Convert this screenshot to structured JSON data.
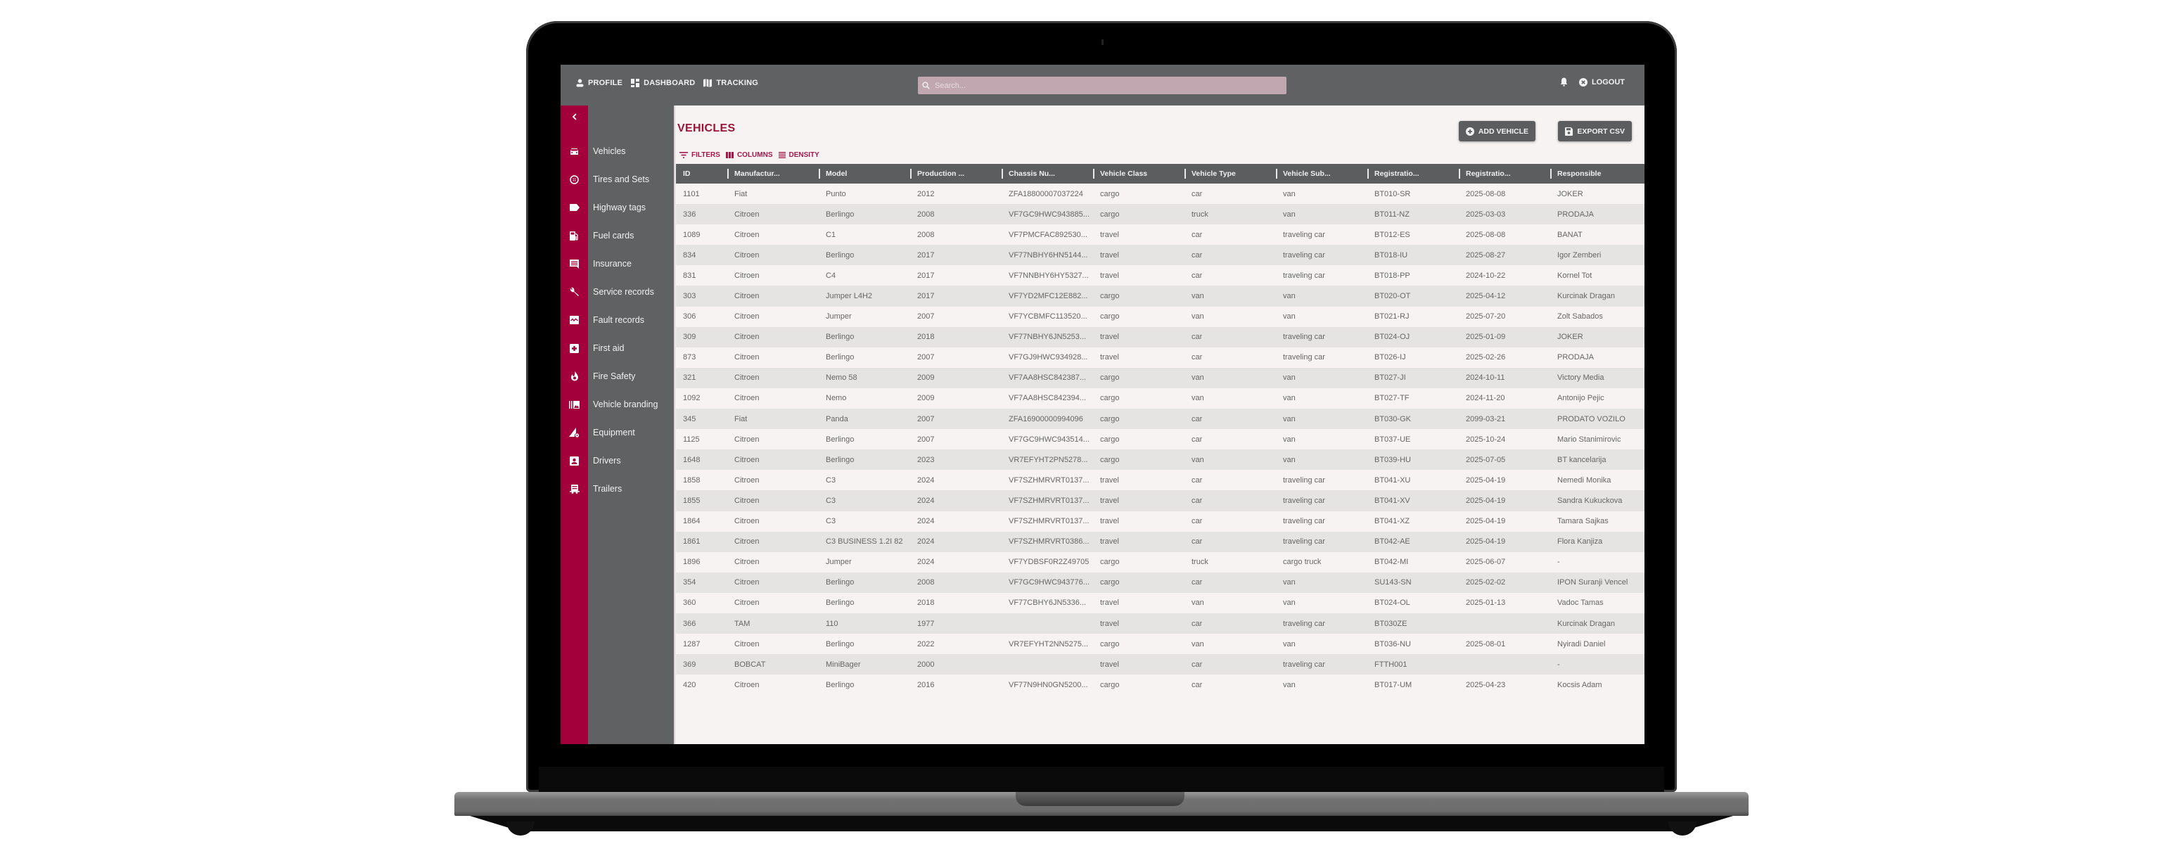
{
  "topbar": {
    "nav": [
      {
        "label": "PROFILE",
        "icon": "person-icon"
      },
      {
        "label": "DASHBOARD",
        "icon": "dashboard-icon"
      },
      {
        "label": "TRACKING",
        "icon": "map-icon"
      }
    ],
    "search_placeholder": "Search...",
    "search_value": "",
    "logout_label": "LOGOUT"
  },
  "sidebar": {
    "collapse_icon": "chevron-left-icon",
    "items": [
      {
        "label": "Vehicles",
        "icon": "car-icon"
      },
      {
        "label": "Tires and Sets",
        "icon": "tire-icon"
      },
      {
        "label": "Highway tags",
        "icon": "tag-icon"
      },
      {
        "label": "Fuel cards",
        "icon": "fuel-icon"
      },
      {
        "label": "Insurance",
        "icon": "insurance-icon"
      },
      {
        "label": "Service records",
        "icon": "wrench-icon"
      },
      {
        "label": "Fault records",
        "icon": "fault-icon"
      },
      {
        "label": "First aid",
        "icon": "first-aid-icon"
      },
      {
        "label": "Fire Safety",
        "icon": "fire-icon"
      },
      {
        "label": "Vehicle branding",
        "icon": "branding-icon"
      },
      {
        "label": "Equipment",
        "icon": "equipment-icon"
      },
      {
        "label": "Drivers",
        "icon": "driver-icon"
      },
      {
        "label": "Trailers",
        "icon": "trailer-icon"
      }
    ]
  },
  "page": {
    "title": "VEHICLES",
    "add_button": "ADD VEHICLE",
    "export_button": "EXPORT CSV",
    "toolbar": {
      "filters": "FILTERS",
      "columns": "COLUMNS",
      "density": "DENSITY"
    }
  },
  "colors": {
    "accent": "#a3003b",
    "topbar": "#5f6162",
    "title": "#9c1538"
  },
  "table": {
    "columns": [
      "ID",
      "Manufactur...",
      "Model",
      "Production ...",
      "Chassis Nu...",
      "Vehicle Class",
      "Vehicle Type",
      "Vehicle Sub...",
      "Registratio...",
      "Registratio...",
      "Responsible"
    ],
    "rows": [
      [
        "1101",
        "Fiat",
        "Punto",
        "2012",
        "ZFA18800007037224",
        "cargo",
        "car",
        "van",
        "BT010-SR",
        "2025-08-08",
        "JOKER"
      ],
      [
        "336",
        "Citroen",
        "Berlingo",
        "2008",
        "VF7GC9HWC943885...",
        "cargo",
        "truck",
        "van",
        "BT011-NZ",
        "2025-03-03",
        "PRODAJA"
      ],
      [
        "1089",
        "Citroen",
        "C1",
        "2008",
        "VF7PMCFAC892530...",
        "travel",
        "car",
        "traveling car",
        "BT012-ES",
        "2025-08-08",
        "BANAT"
      ],
      [
        "834",
        "Citroen",
        "Berlingo",
        "2017",
        "VF77NBHY6HN5144...",
        "travel",
        "car",
        "traveling car",
        "BT018-IU",
        "2025-08-27",
        "Igor Zemberi"
      ],
      [
        "831",
        "Citroen",
        "C4",
        "2017",
        "VF7NNBHY6HY5327...",
        "travel",
        "car",
        "traveling car",
        "BT018-PP",
        "2024-10-22",
        "Kornel Tot"
      ],
      [
        "303",
        "Citroen",
        "Jumper L4H2",
        "2017",
        "VF7YD2MFC12E882...",
        "cargo",
        "van",
        "van",
        "BT020-OT",
        "2025-04-12",
        "Kurcinak Dragan"
      ],
      [
        "306",
        "Citroen",
        "Jumper",
        "2007",
        "VF7YCBMFC113520...",
        "cargo",
        "van",
        "van",
        "BT021-RJ",
        "2025-07-20",
        "Zolt Sabados"
      ],
      [
        "309",
        "Citroen",
        "Berlingo",
        "2018",
        "VF77NBHY6JN5253...",
        "travel",
        "car",
        "traveling car",
        "BT024-OJ",
        "2025-01-09",
        "JOKER"
      ],
      [
        "873",
        "Citroen",
        "Berlingo",
        "2007",
        "VF7GJ9HWC934928...",
        "travel",
        "car",
        "traveling car",
        "BT026-IJ",
        "2025-02-26",
        "PRODAJA"
      ],
      [
        "321",
        "Citroen",
        "Nemo 58",
        "2009",
        "VF7AA8HSC842387...",
        "cargo",
        "van",
        "van",
        "BT027-JI",
        "2024-10-11",
        "Victory Media"
      ],
      [
        "1092",
        "Citroen",
        "Nemo",
        "2009",
        "VF7AA8HSC842394...",
        "cargo",
        "van",
        "van",
        "BT027-TF",
        "2024-11-20",
        "Antonijo Pejic"
      ],
      [
        "345",
        "Fiat",
        "Panda",
        "2007",
        "ZFA16900000994096",
        "cargo",
        "car",
        "van",
        "BT030-GK",
        "2099-03-21",
        "PRODATO VOZILO"
      ],
      [
        "1125",
        "Citroen",
        "Berlingo",
        "2007",
        "VF7GC9HWC943514...",
        "cargo",
        "car",
        "van",
        "BT037-UE",
        "2025-10-24",
        "Mario Stanimirovic"
      ],
      [
        "1648",
        "Citroen",
        "Berlingo",
        "2023",
        "VR7EFYHT2PN5278...",
        "cargo",
        "van",
        "van",
        "BT039-HU",
        "2025-07-05",
        "BT kancelarija"
      ],
      [
        "1858",
        "Citroen",
        "C3",
        "2024",
        "VF7SZHMRVRT0137...",
        "travel",
        "car",
        "traveling car",
        "BT041-XU",
        "2025-04-19",
        "Nemedi Monika"
      ],
      [
        "1855",
        "Citroen",
        "C3",
        "2024",
        "VF7SZHMRVRT0137...",
        "travel",
        "car",
        "traveling car",
        "BT041-XV",
        "2025-04-19",
        "Sandra Kukuckova"
      ],
      [
        "1864",
        "Citroen",
        "C3",
        "2024",
        "VF7SZHMRVRT0137...",
        "travel",
        "car",
        "traveling car",
        "BT041-XZ",
        "2025-04-19",
        "Tamara Sajkas"
      ],
      [
        "1861",
        "Citroen",
        "C3 BUSINESS 1.2I 82",
        "2024",
        "VF7SZHMRVRT0386...",
        "travel",
        "car",
        "traveling car",
        "BT042-AE",
        "2025-04-19",
        "Flora Kanjiza"
      ],
      [
        "1896",
        "Citroen",
        "Jumper",
        "2024",
        "VF7YDBSF0R2Z49705",
        "cargo",
        "truck",
        "cargo truck",
        "BT042-MI",
        "2025-06-07",
        "-"
      ],
      [
        "354",
        "Citroen",
        "Berlingo",
        "2008",
        "VF7GC9HWC943776...",
        "cargo",
        "car",
        "van",
        "SU143-SN",
        "2025-02-02",
        "IPON Suranji Vencel"
      ],
      [
        "360",
        "Citroen",
        "Berlingo",
        "2018",
        "VF77CBHY6JN5336...",
        "travel",
        "van",
        "van",
        "BT024-OL",
        "2025-01-13",
        "Vadoc Tamas"
      ],
      [
        "366",
        "TAM",
        "110",
        "1977",
        "",
        "travel",
        "car",
        "traveling car",
        "BT030ZE",
        "",
        "Kurcinak Dragan"
      ],
      [
        "1287",
        "Citroen",
        "Berlingo",
        "2022",
        "VR7EFYHT2NN5275...",
        "cargo",
        "van",
        "van",
        "BT036-NU",
        "2025-08-01",
        "Nyiradi Daniel"
      ],
      [
        "369",
        "BOBCAT",
        "MiniBager",
        "2000",
        "",
        "travel",
        "car",
        "traveling car",
        "FTTH001",
        "",
        "-"
      ],
      [
        "420",
        "Citroen",
        "Berlingo",
        "2016",
        "VF77N9HN0GN5200...",
        "cargo",
        "car",
        "van",
        "BT017-UM",
        "2025-04-23",
        "Kocsis Adam"
      ]
    ]
  }
}
